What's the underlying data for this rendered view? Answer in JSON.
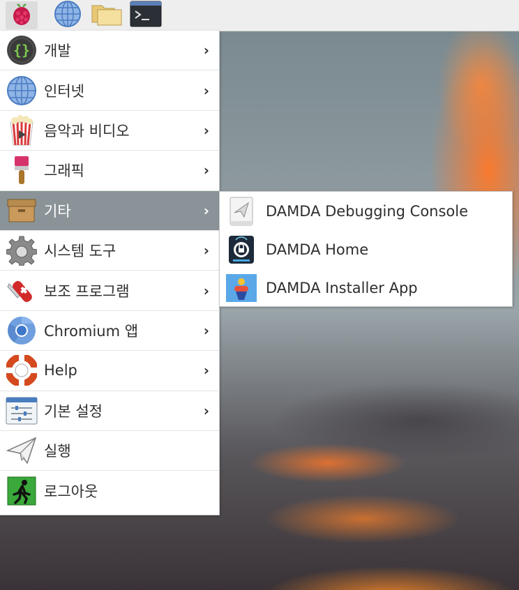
{
  "taskbar": {
    "buttons": [
      {
        "name": "raspberry-menu-button",
        "icon": "raspberry-icon"
      },
      {
        "name": "web-browser-button",
        "icon": "globe-icon"
      },
      {
        "name": "file-manager-button",
        "icon": "folder-icon"
      },
      {
        "name": "terminal-button",
        "icon": "terminal-icon"
      }
    ]
  },
  "menu": {
    "items": [
      {
        "label": "개발",
        "icon": "code-braces-icon",
        "has_submenu": true
      },
      {
        "label": "인터넷",
        "icon": "globe-icon",
        "has_submenu": true
      },
      {
        "label": "음악과 비디오",
        "icon": "popcorn-media-icon",
        "has_submenu": true
      },
      {
        "label": "그래픽",
        "icon": "paintbrush-icon",
        "has_submenu": true
      },
      {
        "label": "기타",
        "icon": "box-icon",
        "has_submenu": true,
        "selected": true
      },
      {
        "label": "시스템 도구",
        "icon": "gear-icon",
        "has_submenu": true
      },
      {
        "label": "보조 프로그램",
        "icon": "swiss-knife-icon",
        "has_submenu": true
      },
      {
        "label": "Chromium 앱",
        "icon": "chromium-icon",
        "has_submenu": true
      },
      {
        "label": "Help",
        "icon": "lifebuoy-icon",
        "has_submenu": true
      },
      {
        "label": "기본 설정",
        "icon": "settings-sliders-icon",
        "has_submenu": true
      },
      {
        "label": "실행",
        "icon": "paper-plane-icon",
        "has_submenu": false
      },
      {
        "label": "로그아웃",
        "icon": "exit-running-man-icon",
        "has_submenu": false
      }
    ],
    "chevron": "›"
  },
  "submenu": {
    "items": [
      {
        "label": "DAMDA Debugging Console",
        "icon": "console-plane-icon"
      },
      {
        "label": "DAMDA Home",
        "icon": "damda-home-icon"
      },
      {
        "label": "DAMDA Installer App",
        "icon": "damda-installer-icon"
      }
    ]
  },
  "colors": {
    "selected_bg": "#8a9498",
    "menu_bg": "#ffffff",
    "taskbar_bg": "#eeeeee"
  }
}
